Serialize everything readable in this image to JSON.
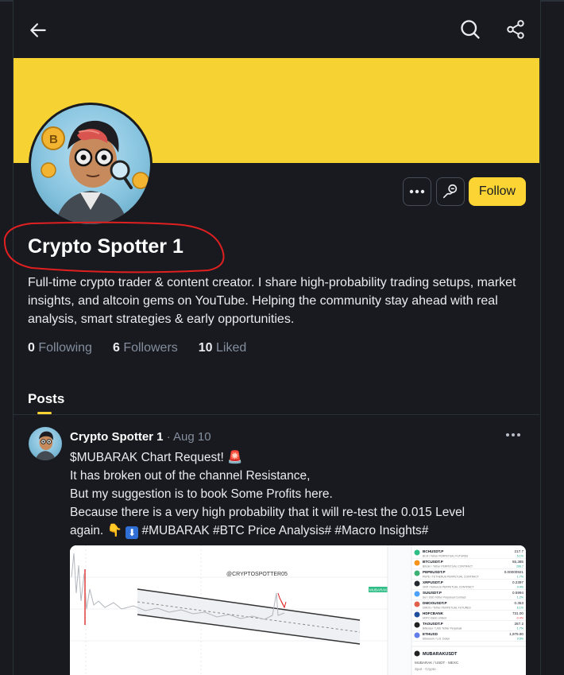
{
  "header": {
    "back_icon": "arrow-left-icon",
    "search_icon": "search-icon",
    "share_icon": "share-icon"
  },
  "profile": {
    "name": "Crypto Spotter 1",
    "bio": "Full-time crypto trader & content creator. I share high-probability trading setups, market insights, and altcoin gems on YouTube. Helping the community stay ahead with real analysis, smart strategies & early opportunities.",
    "stats": {
      "following_count": "0",
      "following_label": "Following",
      "followers_count": "6",
      "followers_label": "Followers",
      "liked_count": "10",
      "liked_label": "Liked"
    },
    "follow_label": "Follow"
  },
  "tabs": {
    "posts_label": "Posts"
  },
  "post": {
    "author": "Crypto Spotter 1",
    "date": "· Aug 10",
    "lines": [
      "$MUBARAK Chart Request! 🚨",
      "It has broken out of the channel Resistance,",
      "But my suggestion is to book Some Profits here.",
      "Because there is a very high probability that it will re-test the 0.015 Level",
      "again. 👇⬇️ #MUBARAK #BTC Price Analysis# #Macro Insights#"
    ],
    "line_1": "$MUBARAK Chart Request! ",
    "line_2": "It has broken out of the channel Resistance,",
    "line_3": "But my suggestion is to book Some Profits here.",
    "line_4": "Because there is a very high probability that it will re-test the 0.015 Level",
    "line_5_prefix": "again. ",
    "line_5_tags": " #MUBARAK #BTC Price Analysis# #Macro Insights#",
    "chart_watermark": "@CRYPTOSPOTTER05",
    "chart_price_tag": "MUBARAK USDT",
    "watchlist": [
      {
        "sym": "BCHUSDT.P",
        "desc": "BCH / Tether PERPETUAL FUTURES",
        "price": "217.7",
        "chg": "5.1%",
        "color": "#2ebd85"
      },
      {
        "sym": "BTCUSDT.P",
        "desc": "Bitcoin / Tether PERPETUAL CONTRACT",
        "price": "55,385",
        "chg": "206.7",
        "color": "#f7931a"
      },
      {
        "sym": "PEPEUSDT.P",
        "desc": "PEPE / TETHERUS PERPETUAL CONTRACT",
        "price": "0.00000921",
        "chg": "1.7%",
        "color": "#3bb273"
      },
      {
        "sym": "XRPUSDT.P",
        "desc": "XRP / TetherUS PERPETUAL CONTRACT",
        "price": "0.2397",
        "chg": "0.4%",
        "color": "#23292f"
      },
      {
        "sym": "SUIUSDT.P",
        "desc": "Sui / USD Tether Perpetual Contract",
        "price": "0.5994",
        "chg": "1.2%",
        "color": "#4da2ff"
      },
      {
        "sym": "DMOOUSDT.P",
        "desc": "DMOO / Tether PERPETUAL FUTURES",
        "price": "0.353",
        "chg": "6.1%",
        "color": "#e0604a"
      },
      {
        "sym": "HDFCBANK",
        "desc": "HDFC Bank Limited",
        "price": "731.00",
        "chg": "-0.4%",
        "color": "#1f4e9c"
      },
      {
        "sym": "TAOUSDT.P",
        "desc": "Bittensor / USD Tether Perpetual",
        "price": "287.2",
        "chg": "1.7%",
        "color": "#222222"
      },
      {
        "sym": "ETHUSD",
        "desc": "Ethereum / U.S. Dollar",
        "price": "1,979.90",
        "chg": "0.5%",
        "color": "#627eea"
      }
    ],
    "detail_symbol": "MUBARAKUSDT",
    "detail_pair": "MUBARAK / USDT · MEXC",
    "detail_market": "Spot · Crypto"
  },
  "colors": {
    "background": "#181a20",
    "banner": "#f6d232",
    "accent": "#fcd535",
    "muted": "#848e9c",
    "annotation": "#e02020"
  }
}
